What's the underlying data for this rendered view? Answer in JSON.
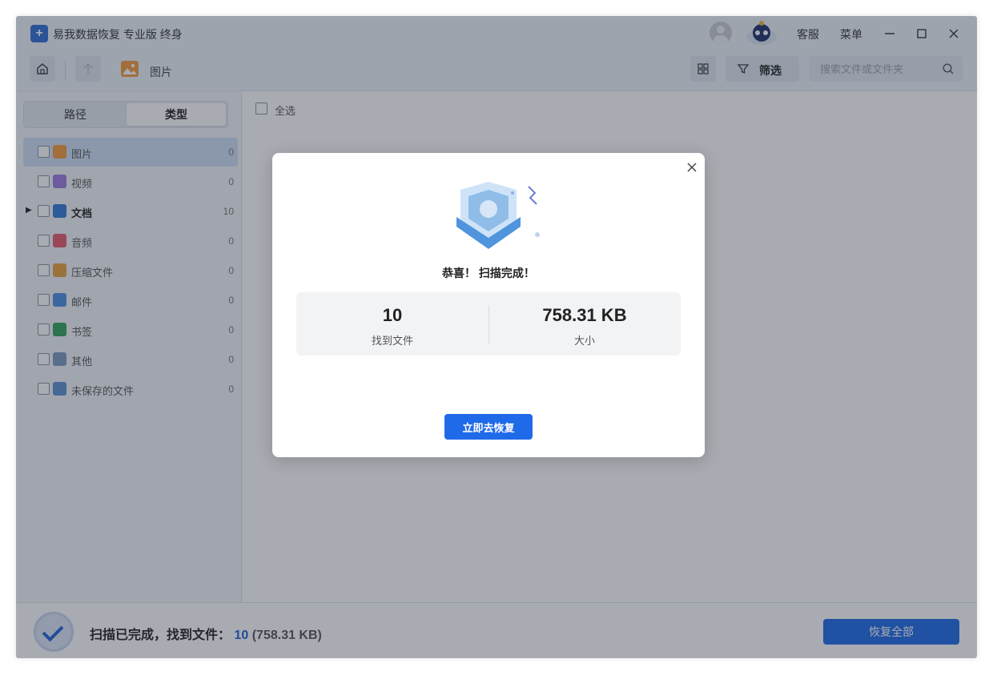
{
  "app": {
    "title": "易我数据恢复 专业版 终身",
    "support_label": "客服",
    "menu_label": "菜单"
  },
  "toolbar": {
    "breadcrumb": "图片",
    "filter_label": "筛选",
    "search_placeholder": "搜索文件或文件夹"
  },
  "sidebar": {
    "tabs": [
      {
        "label": "路径",
        "active": false
      },
      {
        "label": "类型",
        "active": true
      }
    ],
    "categories": [
      {
        "label": "图片",
        "count": "0",
        "icon": "image-icon",
        "color": "#f39a3c",
        "selected": true,
        "expandable": false
      },
      {
        "label": "视频",
        "count": "0",
        "icon": "video-icon",
        "color": "#9b7be0",
        "selected": false,
        "expandable": false
      },
      {
        "label": "文档",
        "count": "10",
        "icon": "document-icon",
        "color": "#2f7ad6",
        "selected": false,
        "expandable": true
      },
      {
        "label": "音频",
        "count": "0",
        "icon": "audio-icon",
        "color": "#e8596b",
        "selected": false,
        "expandable": false
      },
      {
        "label": "压缩文件",
        "count": "0",
        "icon": "archive-icon",
        "color": "#e8a23c",
        "selected": false,
        "expandable": false
      },
      {
        "label": "邮件",
        "count": "0",
        "icon": "mail-icon",
        "color": "#4a8fe0",
        "selected": false,
        "expandable": false
      },
      {
        "label": "书签",
        "count": "0",
        "icon": "bookmark-icon",
        "color": "#2fa35a",
        "selected": false,
        "expandable": false
      },
      {
        "label": "其他",
        "count": "0",
        "icon": "folder-icon",
        "color": "#7c9ac0",
        "selected": false,
        "expandable": false
      },
      {
        "label": "未保存的文件",
        "count": "0",
        "icon": "unsaved-file-icon",
        "color": "#5b8fd0",
        "selected": false,
        "expandable": false
      }
    ]
  },
  "content": {
    "select_all_label": "全选"
  },
  "status": {
    "text": "扫描已完成，找到文件：",
    "count": "10",
    "size": "(758.31 KB)",
    "recover_all_label": "恢复全部"
  },
  "modal": {
    "title": "恭喜！ 扫描完成！",
    "files_value": "10",
    "files_label": "找到文件",
    "size_value": "758.31 KB",
    "size_label": "大小",
    "button_label": "立即去恢复"
  },
  "colors": {
    "accent": "#1f6ae8",
    "selected_row": "#cfdff6"
  }
}
